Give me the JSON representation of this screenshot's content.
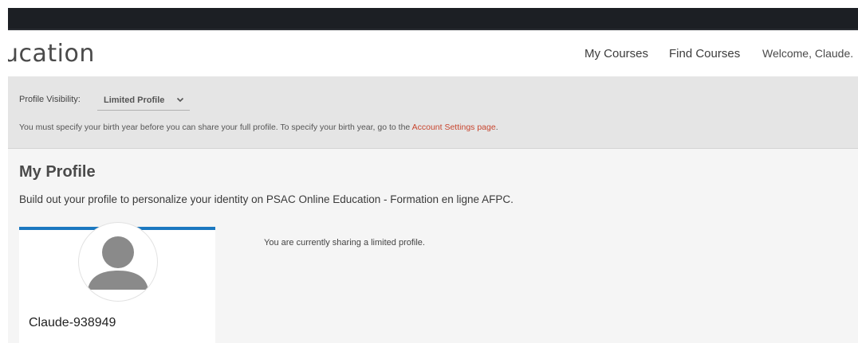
{
  "header": {
    "logo_text": "ucation",
    "nav": {
      "my_courses": "My Courses",
      "find_courses": "Find Courses"
    },
    "welcome": "Welcome, Claude."
  },
  "visibility": {
    "label": "Profile Visibility:",
    "selected": "Limited Profile",
    "note_text": "You must specify your birth year before you can share your full profile. To specify your birth year, go to the ",
    "note_link": "Account Settings page",
    "note_end": "."
  },
  "profile": {
    "title": "My Profile",
    "subtitle": "Build out your profile to personalize your identity on PSAC Online Education - Formation en ligne AFPC.",
    "username": "Claude-938949",
    "sharing_note": "You are currently sharing a limited profile."
  },
  "colors": {
    "top_bar": "#1c1f24",
    "accent_blue": "#1b78c0",
    "link_red": "#c8462f",
    "band_gray": "#e5e5e5"
  },
  "icons": {
    "visibility_dropdown": "chevron-down-icon",
    "avatar": "user-silhouette-icon"
  }
}
